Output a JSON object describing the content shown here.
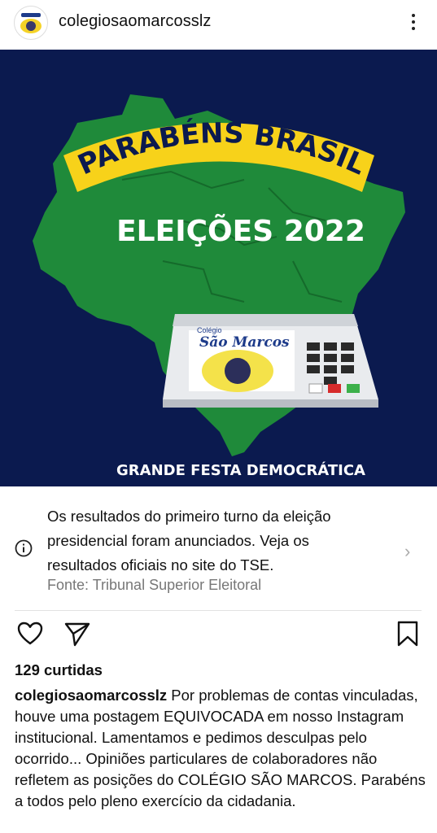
{
  "post": {
    "username": "colegiosaomarcosslz",
    "avatar_icon": "school-logo-icon"
  },
  "image": {
    "banner": "PARABÉNS BRASIL",
    "title": "ELEIÇÕES 2022",
    "footer": "GRANDE FESTA DEMOCRÁTICA",
    "urn_label_top": "Colégio",
    "urn_label_main": "São Marcos",
    "colors": {
      "background": "#0b1a4f",
      "map": "#1f8a3a",
      "banner": "#f7d21a",
      "banner_text": "#0b1a4f"
    }
  },
  "notice": {
    "text": "Os resultados do primeiro turno da eleição presidencial foram anunciados. Veja os resultados oficiais no site do TSE.",
    "source": "Fonte: Tribunal Superior Eleitoral"
  },
  "actions": {
    "like_icon": "heart-icon",
    "share_icon": "send-icon",
    "save_icon": "bookmark-icon"
  },
  "likes": "129 curtidas",
  "caption": {
    "user": "colegiosaomarcosslz",
    "text": " Por problemas de contas vinculadas, houve uma postagem EQUIVOCADA em nosso Instagram institucional. Lamentamos e pedimos desculpas pelo ocorrido... Opiniões particulares de colaboradores não refletem as posições do COLÉGIO SÃO MARCOS. Parabéns a todos pelo pleno exercício da cidadania."
  }
}
